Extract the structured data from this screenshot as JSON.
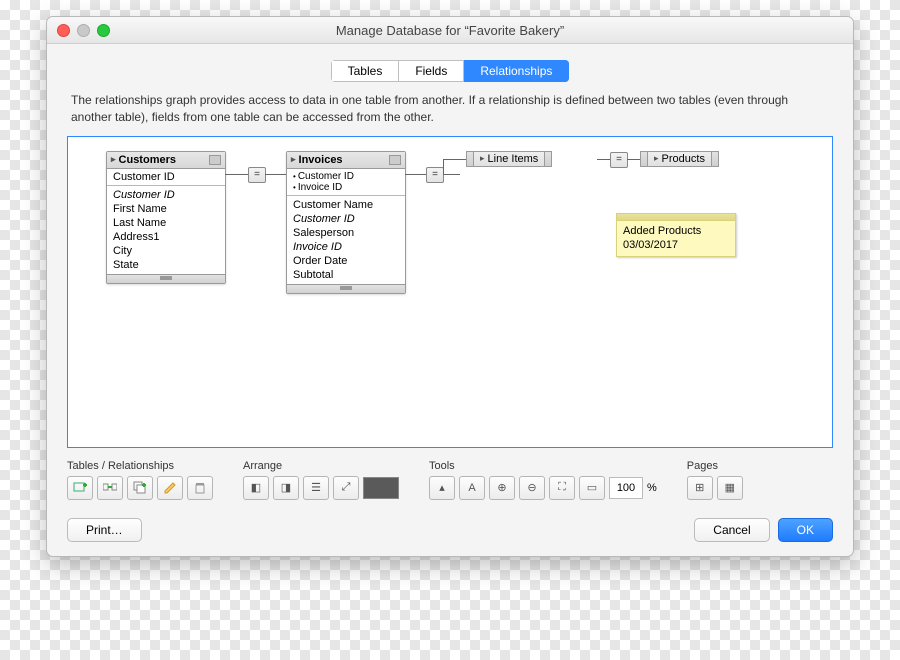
{
  "window": {
    "title": "Manage Database for “Favorite Bakery”"
  },
  "tabs": {
    "items": [
      "Tables",
      "Fields",
      "Relationships"
    ],
    "active": 2
  },
  "description": "The relationships graph provides access to data in one table from another. If a relationship is defined between two tables (even through another table), fields from one table can be accessed from the other.",
  "tables": {
    "customers": {
      "name": "Customers",
      "key": "Customer ID",
      "fields": [
        "Customer ID",
        "First Name",
        "Last Name",
        "Address1",
        "City",
        "State"
      ],
      "italic": [
        0
      ]
    },
    "invoices": {
      "name": "Invoices",
      "keys": [
        "Customer ID",
        "Invoice ID"
      ],
      "fields": [
        "Customer Name",
        "Customer ID",
        "Salesperson",
        "Invoice ID",
        "Order Date",
        "Subtotal"
      ],
      "italic": [
        1,
        3
      ]
    },
    "lineitems": {
      "name": "Line Items"
    },
    "products": {
      "name": "Products"
    }
  },
  "note": {
    "line1": "Added Products",
    "line2": "03/03/2017"
  },
  "relation_op": "=",
  "toolbar": {
    "groups": {
      "tables": "Tables / Relationships",
      "arrange": "Arrange",
      "tools": "Tools",
      "pages": "Pages"
    },
    "zoom_value": "100",
    "zoom_suffix": "%"
  },
  "footer": {
    "print": "Print…",
    "cancel": "Cancel",
    "ok": "OK"
  }
}
